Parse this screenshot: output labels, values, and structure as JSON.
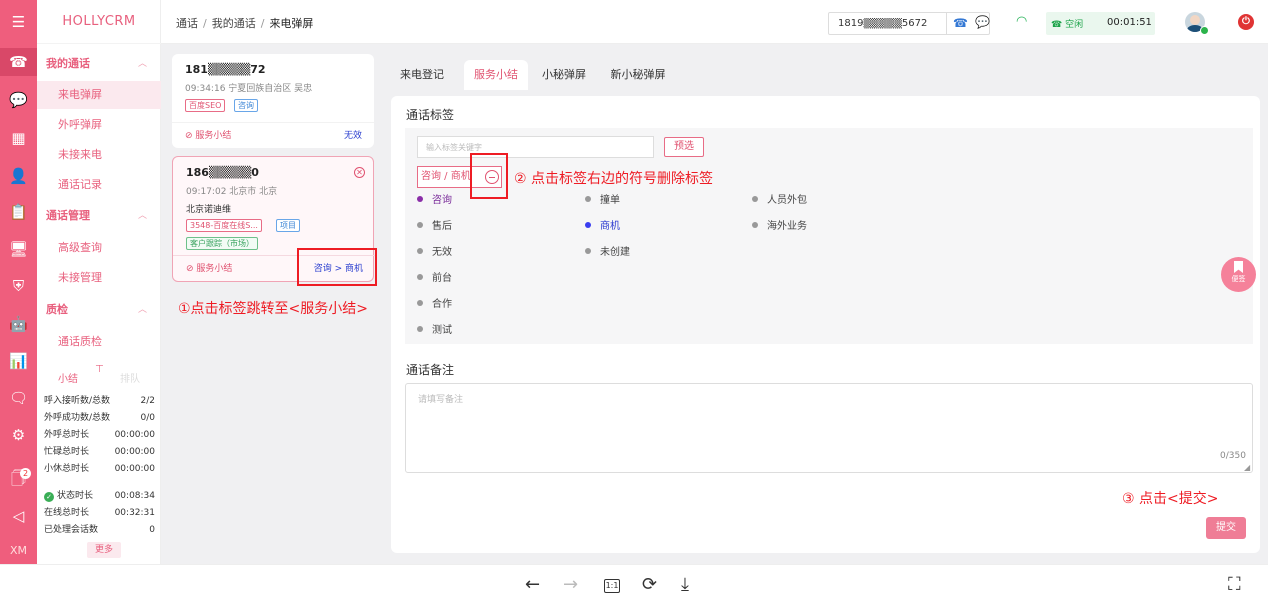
{
  "app": {
    "brand": "HOLLYCRM"
  },
  "rail": {
    "user_label": "XM",
    "badge_count": "2"
  },
  "nav": {
    "groups": [
      {
        "label": "我的通话",
        "items": [
          "来电弹屏",
          "外呼弹屏",
          "未接来电",
          "通话记录"
        ]
      },
      {
        "label": "通话管理",
        "items": [
          "高级查询",
          "未接管理"
        ]
      },
      {
        "label": "质检",
        "items": [
          "通话质检"
        ]
      }
    ],
    "summary_tabs": [
      "小结",
      "排队"
    ],
    "stats": [
      {
        "label": "呼入接听数/总数",
        "value": "2/2"
      },
      {
        "label": "外呼成功数/总数",
        "value": "0/0"
      },
      {
        "label": "外呼总时长",
        "value": "00:00:00"
      },
      {
        "label": "忙碌总时长",
        "value": "00:00:00"
      },
      {
        "label": "小休总时长",
        "value": "00:00:00"
      },
      {
        "label": "状态时长",
        "value": "00:08:34"
      },
      {
        "label": "在线总时长",
        "value": "00:32:31"
      },
      {
        "label": "已处理会话数",
        "value": "0"
      }
    ],
    "more_label": "更多"
  },
  "header": {
    "breadcrumb": [
      "通话",
      "我的通话",
      "来电弹屏"
    ],
    "phone_value": "1819▒▒▒▒▒5672",
    "status_label": "☎ 空闲",
    "status_timer": "00:01:51",
    "power_glyph": "⏻"
  },
  "calls": [
    {
      "number": "181▒▒▒▒▒72",
      "meta": "09:34:16 宁夏回族自治区 吴忠",
      "company": "",
      "tags": [
        "百度SEO",
        "咨询"
      ],
      "summary_label": "⊘ 服务小结",
      "summary_value": "无效"
    },
    {
      "number": "186▒▒▒▒▒0",
      "meta": "09:17:02 北京市 北京",
      "company": "北京诺迪维",
      "tags": [
        "3548-百度在线S...",
        "项目",
        "客户跟踪（市场）"
      ],
      "summary_label": "⊘ 服务小结",
      "summary_value": "咨询 > 商机"
    }
  ],
  "tabs": [
    "来电登记",
    "服务小结",
    "小秘弹屏",
    "新小秘弹屏"
  ],
  "summary_panel": {
    "tags_title": "通话标签",
    "search_placeholder": "输入标签关键字",
    "filter_label": "预选",
    "selected_tag": "咨询 / 商机",
    "options_col1": [
      "咨询",
      "售后",
      "无效",
      "前台",
      "合作",
      "测试"
    ],
    "options_col2": [
      "撞单",
      "商机",
      "未创建"
    ],
    "options_col3": [
      "人员外包",
      "海外业务"
    ],
    "remark_title": "通话备注",
    "remark_placeholder": "请填写备注",
    "counter": "0/350",
    "submit_label": "提交"
  },
  "bookmark_label": "便签",
  "annotations": {
    "step1": "①点击标签跳转至<服务小结>",
    "step2": "② 点击标签右边的符号删除标签",
    "step3": "③ 点击<提交>"
  },
  "viewer": {
    "prev": "←",
    "next": "→",
    "actual_size": "1:1",
    "rotate": "⟳",
    "download": "⤓",
    "fullscreen": "⛶"
  },
  "colors": {
    "brand": "#ef5e7d",
    "annotation": "#ee1c24",
    "online": "#2cb55c"
  }
}
